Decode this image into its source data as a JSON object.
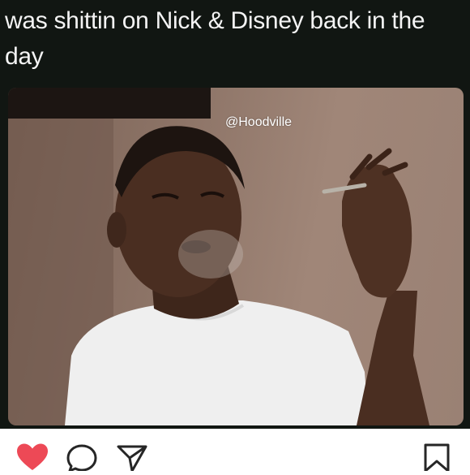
{
  "post": {
    "caption": "was shittin on Nick & Disney back in the day",
    "watermark": "@Hoodville"
  },
  "actions": {
    "like_icon": "heart-icon",
    "comment_icon": "speech-bubble-icon",
    "share_icon": "paper-plane-icon",
    "save_icon": "bookmark-icon",
    "like_color": "#ed4956"
  }
}
